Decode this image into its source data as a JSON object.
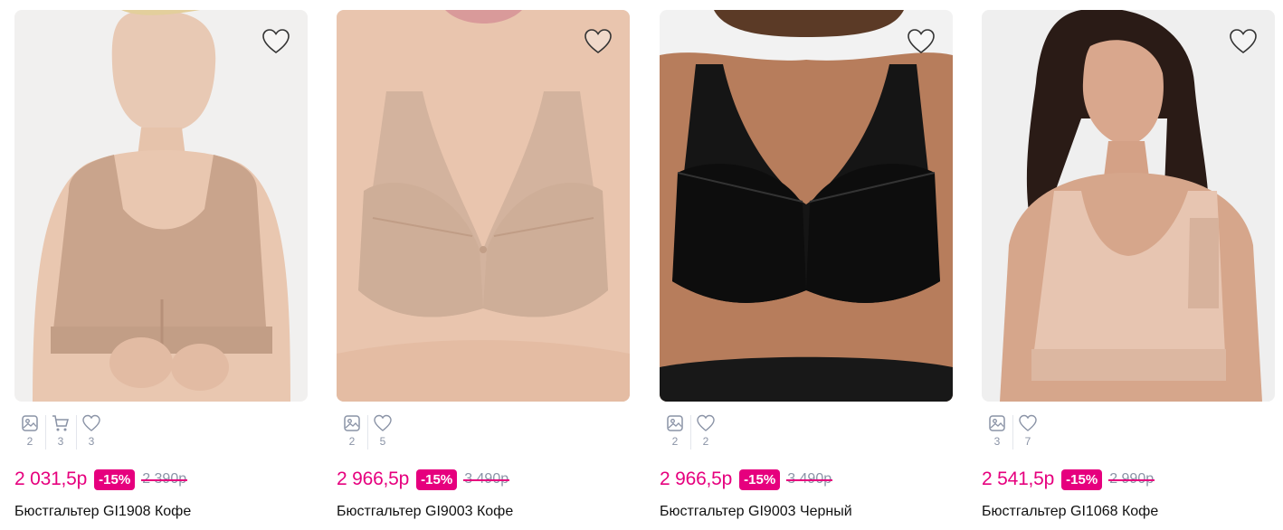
{
  "colors": {
    "accent": "#e6007e",
    "muted": "#8a93a6",
    "divider": "#e3e6ec"
  },
  "products": [
    {
      "title": "Бюстгальтер GI1908 Кофе",
      "price": "2 031,5р",
      "discount": "-15%",
      "old_price": "2 390р",
      "photos_count": "2",
      "cart_count": "3",
      "likes_count": "3"
    },
    {
      "title": "Бюстгальтер GI9003 Кофе",
      "price": "2 966,5р",
      "discount": "-15%",
      "old_price": "3 490р",
      "photos_count": "2",
      "likes_count": "5"
    },
    {
      "title": "Бюстгальтер GI9003 Черный",
      "price": "2 966,5р",
      "discount": "-15%",
      "old_price": "3 490р",
      "photos_count": "2",
      "likes_count": "2"
    },
    {
      "title": "Бюстгальтер GI1068 Кофе",
      "price": "2 541,5р",
      "discount": "-15%",
      "old_price": "2 990р",
      "photos_count": "3",
      "likes_count": "7"
    }
  ]
}
